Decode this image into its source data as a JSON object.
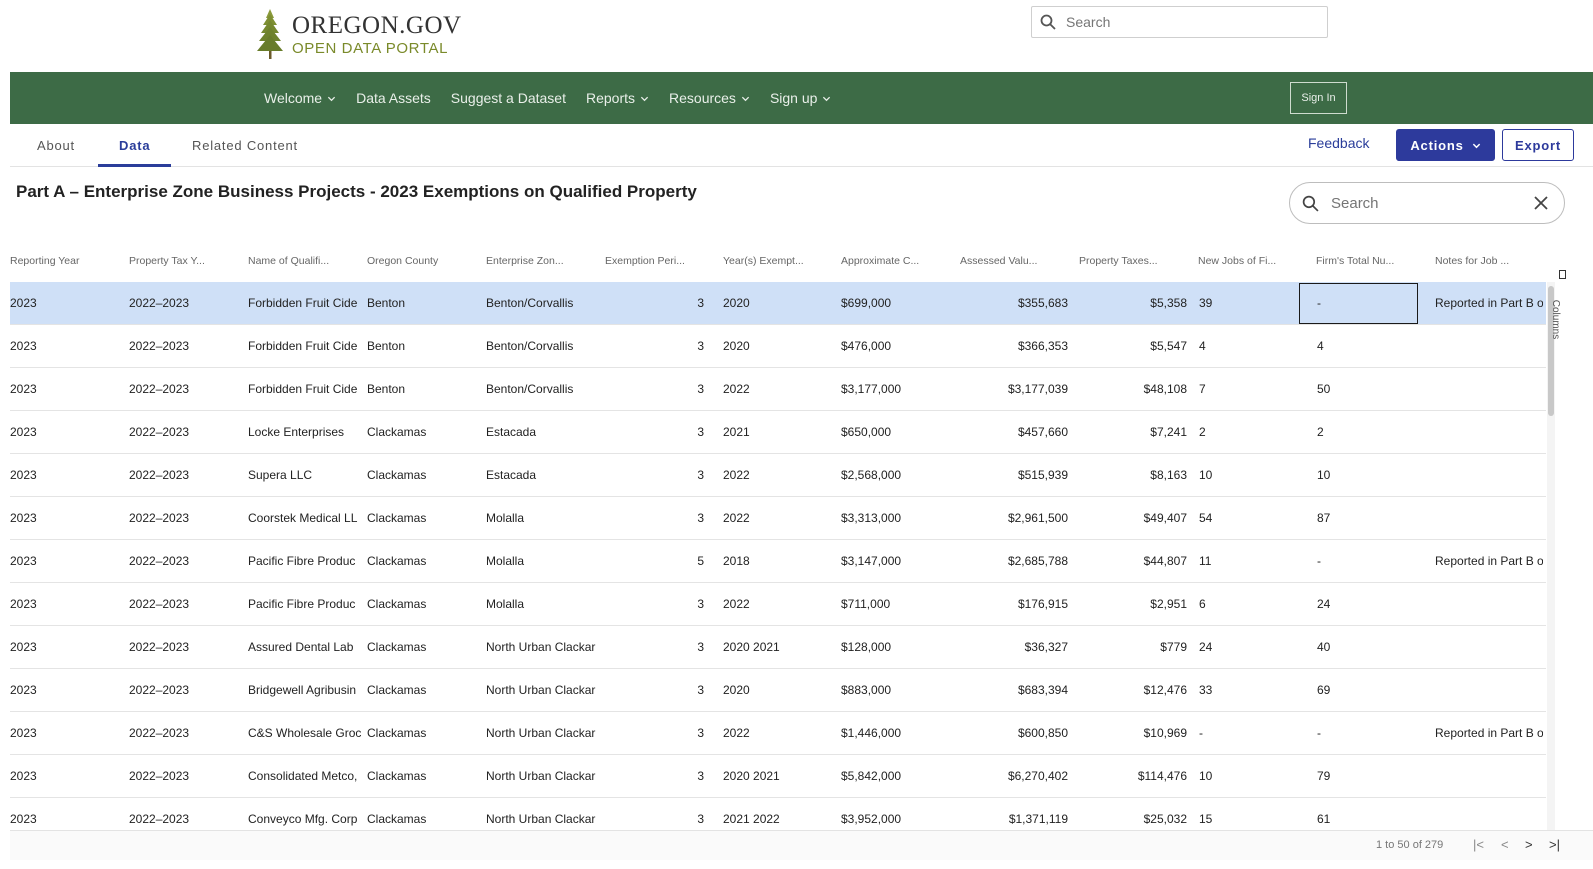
{
  "header": {
    "logo_top": "OREGON.GOV",
    "logo_bottom": "OPEN DATA PORTAL",
    "search_placeholder": "Search"
  },
  "nav": {
    "items": [
      {
        "label": "Welcome",
        "dropdown": true
      },
      {
        "label": "Data Assets",
        "dropdown": false
      },
      {
        "label": "Suggest a Dataset",
        "dropdown": false
      },
      {
        "label": "Reports",
        "dropdown": true
      },
      {
        "label": "Resources",
        "dropdown": true
      },
      {
        "label": "Sign up",
        "dropdown": true
      }
    ],
    "signin_label": "Sign In"
  },
  "tabs": {
    "items": [
      "About",
      "Data",
      "Related Content"
    ],
    "active": "Data",
    "feedback_label": "Feedback",
    "actions_label": "Actions",
    "export_label": "Export"
  },
  "dataset": {
    "title": "Part A – Enterprise Zone Business Projects - 2023 Exemptions on Qualified Property",
    "search_placeholder": "Search"
  },
  "table": {
    "columns": [
      "Reporting Year",
      "Property Tax Y...",
      "Name of Qualifi...",
      "Oregon County",
      "Enterprise Zon...",
      "Exemption Peri...",
      "Year(s) Exempt...",
      "Approximate C...",
      "Assessed Valu...",
      "Property Taxes...",
      "New Jobs of Fi...",
      "Firm's Total Nu...",
      "Notes for Job ..."
    ],
    "rows": [
      [
        "2023",
        "2022–2023",
        "Forbidden Fruit Cide",
        "Benton",
        "Benton/Corvallis",
        "3",
        "2020",
        "$699,000",
        "$355,683",
        "$5,358",
        "39",
        "-",
        "Reported in Part B o"
      ],
      [
        "2023",
        "2022–2023",
        "Forbidden Fruit Cide",
        "Benton",
        "Benton/Corvallis",
        "3",
        "2020",
        "$476,000",
        "$366,353",
        "$5,547",
        "4",
        "4",
        ""
      ],
      [
        "2023",
        "2022–2023",
        "Forbidden Fruit Cide",
        "Benton",
        "Benton/Corvallis",
        "3",
        "2022",
        "$3,177,000",
        "$3,177,039",
        "$48,108",
        "7",
        "50",
        ""
      ],
      [
        "2023",
        "2022–2023",
        "Locke Enterprises",
        "Clackamas",
        "Estacada",
        "3",
        "2021",
        "$650,000",
        "$457,660",
        "$7,241",
        "2",
        "2",
        ""
      ],
      [
        "2023",
        "2022–2023",
        "Supera LLC",
        "Clackamas",
        "Estacada",
        "3",
        "2022",
        "$2,568,000",
        "$515,939",
        "$8,163",
        "10",
        "10",
        ""
      ],
      [
        "2023",
        "2022–2023",
        "Coorstek Medical LL",
        "Clackamas",
        "Molalla",
        "3",
        "2022",
        "$3,313,000",
        "$2,961,500",
        "$49,407",
        "54",
        "87",
        ""
      ],
      [
        "2023",
        "2022–2023",
        "Pacific Fibre Produc",
        "Clackamas",
        "Molalla",
        "5",
        "2018",
        "$3,147,000",
        "$2,685,788",
        "$44,807",
        "11",
        "-",
        "Reported in Part B o"
      ],
      [
        "2023",
        "2022–2023",
        "Pacific Fibre Produc",
        "Clackamas",
        "Molalla",
        "3",
        "2022",
        "$711,000",
        "$176,915",
        "$2,951",
        "6",
        "24",
        ""
      ],
      [
        "2023",
        "2022–2023",
        "Assured Dental Lab",
        "Clackamas",
        "North Urban Clackar",
        "3",
        "2020 2021",
        "$128,000",
        "$36,327",
        "$779",
        "24",
        "40",
        ""
      ],
      [
        "2023",
        "2022–2023",
        "Bridgewell Agribusin",
        "Clackamas",
        "North Urban Clackar",
        "3",
        "2020",
        "$883,000",
        "$683,394",
        "$12,476",
        "33",
        "69",
        ""
      ],
      [
        "2023",
        "2022–2023",
        "C&S Wholesale Groc",
        "Clackamas",
        "North Urban Clackar",
        "3",
        "2022",
        "$1,446,000",
        "$600,850",
        "$10,969",
        "-",
        "-",
        "Reported in Part B o"
      ],
      [
        "2023",
        "2022–2023",
        "Consolidated Metco,",
        "Clackamas",
        "North Urban Clackar",
        "3",
        "2020 2021",
        "$5,842,000",
        "$6,270,402",
        "$114,476",
        "10",
        "79",
        ""
      ],
      [
        "2023",
        "2022–2023",
        "Conveyco Mfg. Corp",
        "Clackamas",
        "North Urban Clackar",
        "3",
        "2021 2022",
        "$3,952,000",
        "$1,371,119",
        "$25,032",
        "15",
        "61",
        ""
      ]
    ],
    "side_panel_label": "Columns"
  },
  "pagination": {
    "text": "1 to 50 of 279",
    "first": "|<",
    "prev": "<",
    "next": ">",
    "last": ">|"
  },
  "colors": {
    "nav_bg": "#3d6b46",
    "accent": "#2d3a9c",
    "selected_row": "#cfe0f7",
    "logo_green": "#7a8a2a"
  }
}
